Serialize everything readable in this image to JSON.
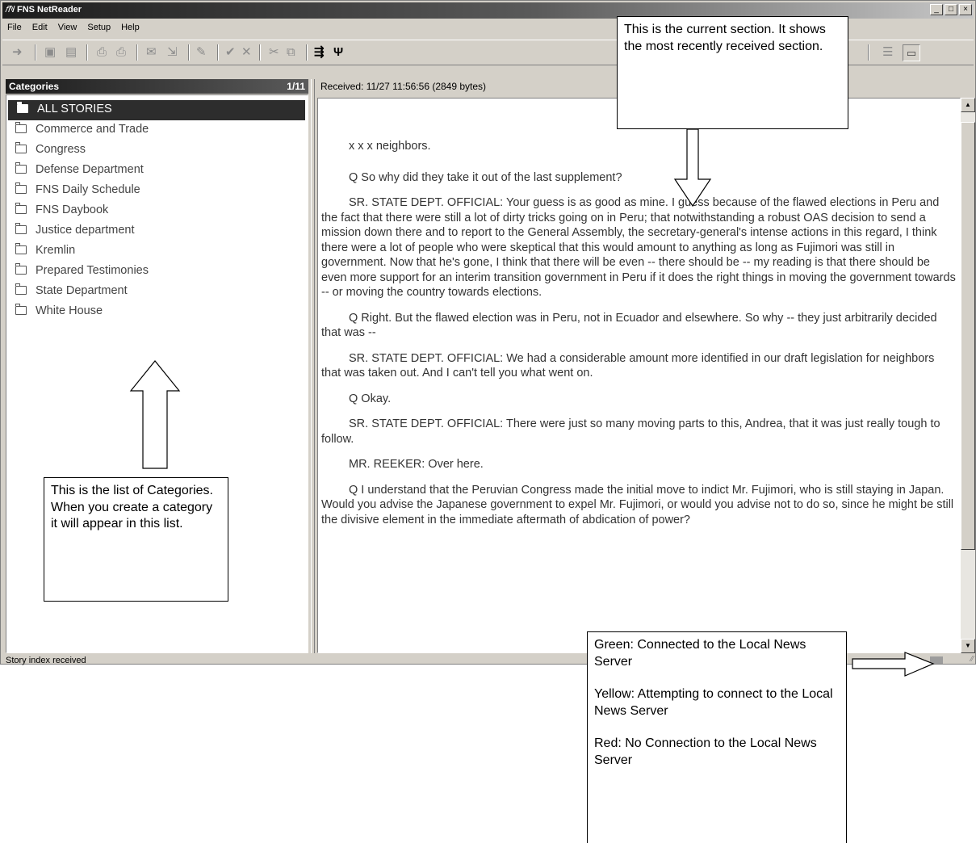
{
  "window": {
    "title": "FNS NetReader",
    "controls": [
      "_",
      "□",
      "×"
    ]
  },
  "menu": [
    "File",
    "Edit",
    "View",
    "Setup",
    "Help"
  ],
  "toolbar_icons": [
    "back-arrow-icon",
    "save-icon",
    "save-all-icon",
    "print-icon",
    "print-preview-icon",
    "mail-icon",
    "forward-mail-icon",
    "highlight-icon",
    "check-icon",
    "delete-icon",
    "cut-icon",
    "copy-icon",
    "network-icon",
    "tools-icon",
    "split-view-icon",
    "full-view-icon"
  ],
  "categories": {
    "header": "Categories",
    "count": "1/11",
    "items": [
      {
        "label": "ALL STORIES",
        "selected": true
      },
      {
        "label": "Commerce and Trade"
      },
      {
        "label": "Congress"
      },
      {
        "label": "Defense Department"
      },
      {
        "label": "FNS Daily Schedule"
      },
      {
        "label": "FNS Daybook"
      },
      {
        "label": "Justice department"
      },
      {
        "label": "Kremlin"
      },
      {
        "label": "Prepared Testimonies"
      },
      {
        "label": "State Department"
      },
      {
        "label": "White House"
      }
    ]
  },
  "story": {
    "received": "Received: 11/27 11:56:56 (2849 bytes)",
    "paragraphs": [
      "x x x neighbors.",
      "Q    So why did they take it out of the last supplement?",
      "SR. STATE DEPT. OFFICIAL:  Your guess is as good as mine.  I guess because of the flawed elections in Peru and the fact that there were still a lot of dirty tricks going on in Peru; that notwithstanding a robust OAS decision to send a mission down there and to report to the General Assembly, the secretary-general's intense actions in this regard, I think there were a lot of people who were skeptical that this would amount to anything as long as Fujimori was still in government. Now that he's gone, I think that there will be even -- there should be -- my reading is that there should be even more support for an interim transition government in Peru if it does the right things in moving the government towards -- or moving the country towards elections.",
      "Q    Right.  But the flawed election was in Peru, not in Ecuador and elsewhere.  So why -- they just arbitrarily decided that was --",
      "SR. STATE DEPT. OFFICIAL:  We had a considerable amount more identified in our draft legislation for neighbors that was taken out. And I can't tell you what went on.",
      "Q    Okay.",
      "SR. STATE DEPT. OFFICIAL:  There were just so many moving parts to this, Andrea, that it was just really tough to follow.",
      "MR. REEKER:  Over here.",
      "Q    I understand that the Peruvian Congress made the initial move to indict Mr. Fujimori, who is still staying in Japan.  Would you advise the Japanese government to expel Mr. Fujimori, or would you advise not to do so, since he might be still the divisive element in the immediate aftermath of abdication of power?"
    ]
  },
  "status": {
    "text": "Story index received"
  },
  "callouts": {
    "section": "This is the current section.  It shows the most recently received section.",
    "categories": "This is the list of Categories.  When you create a category it will appear in this list.",
    "connection": [
      "Green: Connected to the Local News Server",
      "Yellow:  Attempting to connect to the Local News Server",
      "Red: No Connection to the Local News Server"
    ]
  }
}
